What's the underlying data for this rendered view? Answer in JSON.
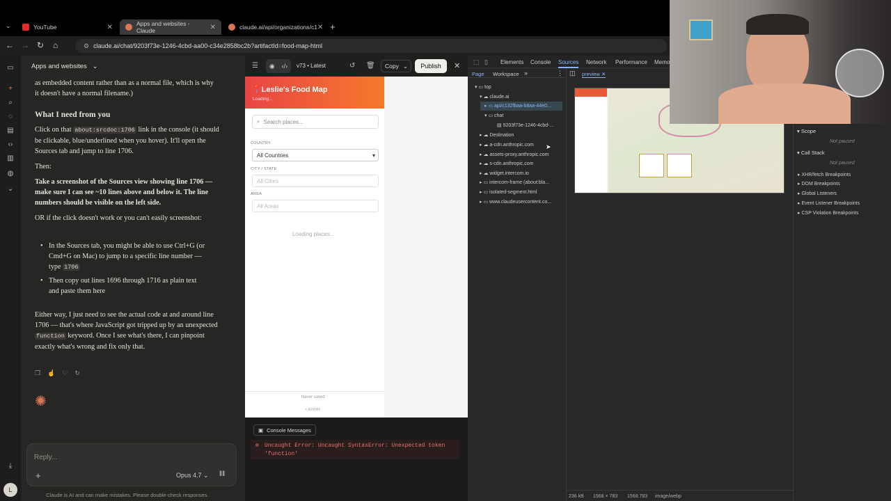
{
  "browser": {
    "tabs": [
      {
        "label": "YouTube",
        "color": "#e32b2b"
      },
      {
        "label": "Apps and websites - Claude",
        "color": "#d97757"
      },
      {
        "label": "claude.ai/api/organizations/c1",
        "color": "#d97757"
      }
    ],
    "url": "claude.ai/chat/9203f73e-1246-4cbd-aa00-c34e2858bc2b?artifactId=food-map-html",
    "new_tab": "+"
  },
  "chat": {
    "title": "Apps and websites",
    "intro": "as embedded content rather than as a normal file, which is why it doesn't have a normal filename.)",
    "heading": "What I need from you",
    "p1_before": "Click on that",
    "p1_code": "about:srcdoc:1706",
    "p1_after": "link in the console (it should be clickable, blue/underlined when you hover). It'll open the Sources tab and jump to line 1706.",
    "then": "Then:",
    "bold": "Take a screenshot of the Sources view showing line 1706 — make sure I can see ~10 lines above and below it. The line numbers should be visible on the left side.",
    "or": "OR if the click doesn't work or you can't easily screenshot:",
    "bullet1": "In the Sources tab, you might be able to use Ctrl+G (or Cmd+G on Mac) to jump to a specific line number — type",
    "bullet1_code": "1706",
    "bullet2": "Then copy out lines 1696 through 1716 as plain text and paste them here",
    "either_before": "Either way, I just need to see the actual code at and around line 1706 — that's where JavaScript got tripped up by an unexpected",
    "either_code": "function",
    "either_after": "keyword. Once I see what's there, I can pinpoint exactly what's wrong and fix only that.",
    "reply_placeholder": "Reply...",
    "model": "Opus 4.7",
    "disclaimer": "Claude is AI and can make mistakes. Please double-check responses.",
    "user_initial": "L"
  },
  "artifact": {
    "version": "v73 • Latest",
    "copy": "Copy",
    "publish": "Publish",
    "app_title": "Leslie's Food Map",
    "app_sub": "Loading...",
    "search_placeholder": "Search places...",
    "country_label": "COUNTRY",
    "country_value": "All Countries",
    "city_label": "CITY / STATE",
    "city_value": "All Cities",
    "area_label": "AREA",
    "area_value": "All Areas",
    "loading": "Loading places...",
    "never_saved": "Never saved",
    "admin": "+ ADMIN"
  },
  "console": {
    "title": "Console Messages",
    "error": "Uncaught Error: Uncaught SyntaxError: Unexpected token 'function'"
  },
  "devtools": {
    "tabs": [
      "Elements",
      "Console",
      "Sources",
      "Network",
      "Performance",
      "Memo"
    ],
    "active_tab": "Sources",
    "subtabs": [
      "Page",
      "Workspace"
    ],
    "file_tab": "preview",
    "tree": [
      "top",
      "claude.ai",
      "api/c132fbaa-b8aa-44e0...",
      "chat",
      "9203f73e-1246-4cbd-...",
      "Destination",
      "a-cdn.anthropic.com",
      "assets-proxy.anthropic.com",
      "s-cdn.anthropic.com",
      "widget.intercom.io",
      "intercom-frame (about:bla...",
      "isolated-segment.html",
      "www.claudeusercontent.co..."
    ],
    "scope": "Scope",
    "not_paused": "Not paused",
    "call_stack": "Call Stack",
    "breakpoints": [
      "XHR/fetch Breakpoints",
      "DOM Breakpoints",
      "Global Listeners",
      "Event Listener Breakpoints",
      "CSP Violation Breakpoints"
    ],
    "status": [
      "236 kB",
      "1568 × 783",
      "1568:783",
      "image/webp"
    ]
  }
}
